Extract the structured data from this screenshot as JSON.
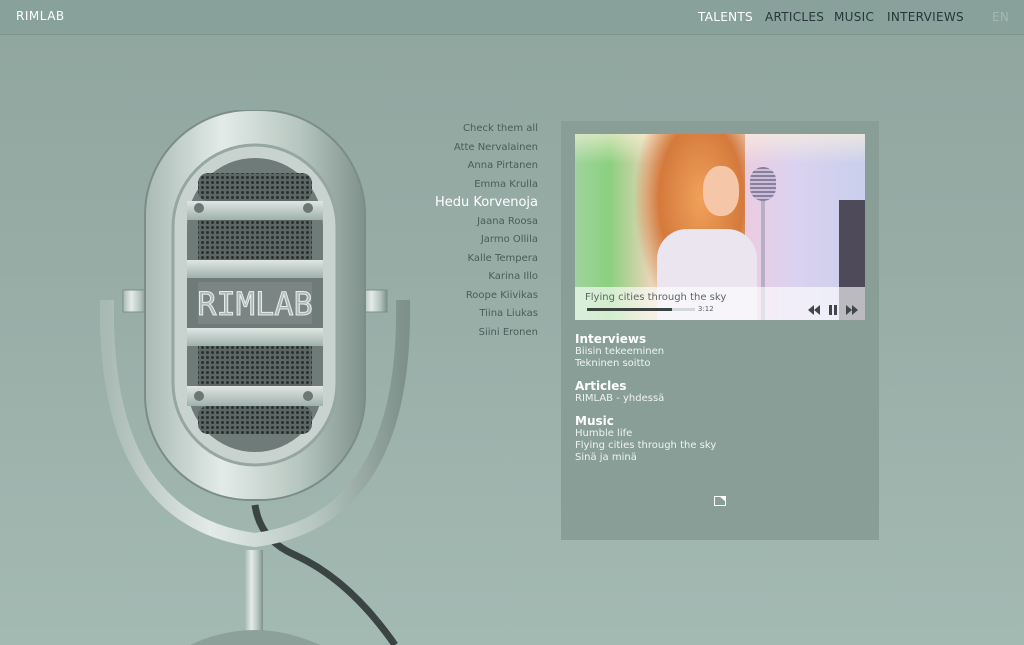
{
  "header": {
    "brand": "RIMLAB",
    "nav": [
      {
        "label": "TALENTS",
        "active": true
      },
      {
        "label": "ARTICLES",
        "active": false
      },
      {
        "label": "MUSIC",
        "active": false
      },
      {
        "label": "INTERVIEWS",
        "active": false
      }
    ],
    "language": "EN"
  },
  "talents": {
    "items": [
      "Check them all",
      "Atte Nervalainen",
      "Anna Pirtanen",
      "Emma Krulla",
      "Hedu Korvenoja",
      "Jaana Roosa",
      "Jarmo Ollila",
      "Kalle Tempera",
      "Karina Illo",
      "Roope Kiivikas",
      "Tiina Liukas",
      "Siini Eronen"
    ],
    "selected": "Hedu Korvenoja"
  },
  "player": {
    "track_title": "Flying cities through the sky",
    "time": "3:12",
    "progress": 0.79,
    "icons": [
      "rewind-icon",
      "pause-icon",
      "fast-forward-icon"
    ]
  },
  "panel": {
    "interviews": {
      "title": "Interviews",
      "items": [
        "Biisin tekeeminen",
        "Tekninen soitto"
      ]
    },
    "articles": {
      "title": "Articles",
      "items": [
        "RIMLAB  - yhdessä"
      ]
    },
    "music": {
      "title": "Music",
      "items": [
        "Humble life",
        "Flying cities through the sky",
        "Sinä ja minä"
      ]
    },
    "expand_icon": "external-link-icon"
  },
  "mic_logo": "RIMLAB",
  "colors": {
    "background": "#97aca5",
    "header": "#88a29b",
    "panel": "#8a9e98",
    "active_nav": "#ffffff"
  }
}
